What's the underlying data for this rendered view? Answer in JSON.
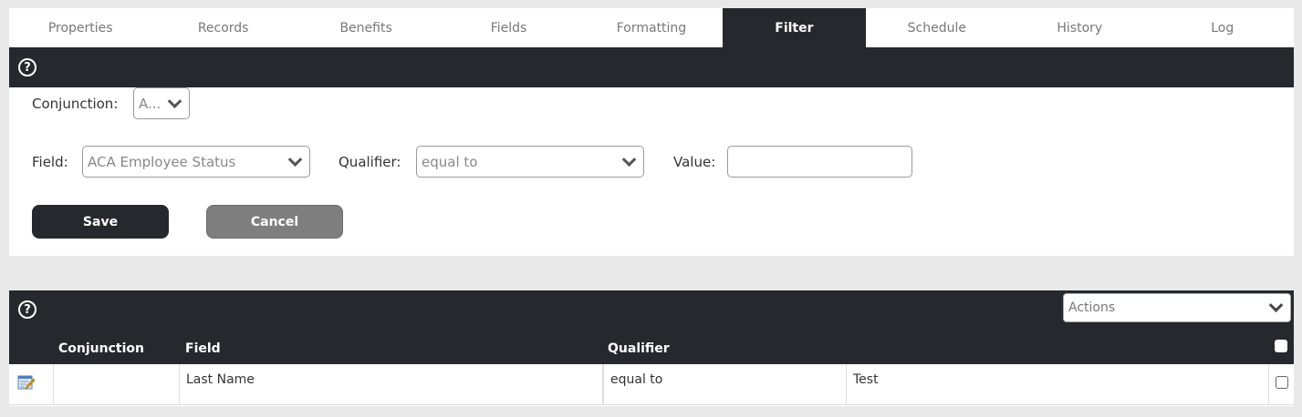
{
  "tabs": [
    {
      "label": "Properties",
      "active": false
    },
    {
      "label": "Records",
      "active": false
    },
    {
      "label": "Benefits",
      "active": false
    },
    {
      "label": "Fields",
      "active": false
    },
    {
      "label": "Formatting",
      "active": false
    },
    {
      "label": "Filter",
      "active": true
    },
    {
      "label": "Schedule",
      "active": false
    },
    {
      "label": "History",
      "active": false
    },
    {
      "label": "Log",
      "active": false
    }
  ],
  "help_glyph": "?",
  "form": {
    "conjunction_label": "Conjunction:",
    "conjunction_value": "A...",
    "field_label": "Field:",
    "field_value": "ACA Employee Status",
    "qualifier_label": "Qualifier:",
    "qualifier_value": "equal to",
    "value_label": "Value:",
    "value_value": "",
    "save_label": "Save",
    "cancel_label": "Cancel"
  },
  "grid": {
    "actions_value": "Actions",
    "columns": [
      "Conjunction",
      "Field",
      "Qualifier"
    ],
    "rows": [
      {
        "conjunction": "",
        "field": "Last Name",
        "qualifier": "equal to",
        "value": "Test"
      }
    ]
  },
  "icons": {
    "help": "help-circle-icon",
    "edit": "edit-row-icon",
    "dropdown": "chevron-down-icon"
  },
  "colors": {
    "dark": "#25282c",
    "accent_button": "#25282c",
    "cancel_button": "#7e7e7e"
  }
}
